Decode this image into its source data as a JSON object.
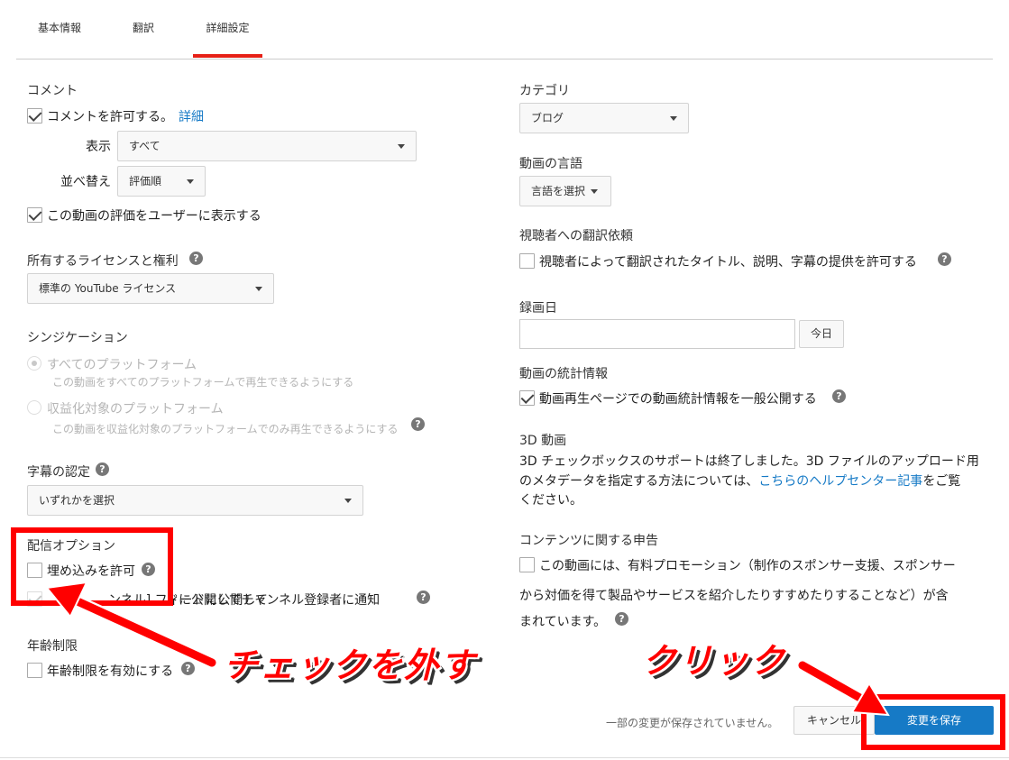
{
  "tabs": [
    "基本情報",
    "翻訳",
    "詳細設定"
  ],
  "left": {
    "comments": {
      "title": "コメント",
      "allow_label": "コメントを許可する。",
      "detail_link": "詳細",
      "display_label": "表示",
      "display_value": "すべて",
      "sort_label": "並べ替え",
      "sort_value": "評価順",
      "show_ratings_label": "この動画の評価をユーザーに表示する"
    },
    "license": {
      "title": "所有するライセンスと権利",
      "value": "標準の YouTube ライセンス"
    },
    "syndication": {
      "title": "シンジケーション",
      "all_platforms": "すべてのプラットフォーム",
      "all_platforms_desc": "この動画をすべてのプラットフォームで再生できるようにする",
      "monetized_platforms": "収益化対象のプラットフォーム",
      "monetized_platforms_desc": "この動画を収益化対象のプラットフォームでのみ再生できるようにする"
    },
    "caption_cert": {
      "title": "字幕の認定",
      "value": "いずれかを選択"
    },
    "distribution": {
      "title": "配信オプション",
      "embed_label": "埋め込みを許可",
      "notify_prefix": "ド",
      "notify_label": "チャンネル登録者に通知",
      "notify_partial": "ンネル] フィードに公開して"
    },
    "age": {
      "title": "年齢制限",
      "enable_label": "年齢制限を有効にする"
    }
  },
  "right": {
    "category": {
      "title": "カテゴリ",
      "value": "ブログ"
    },
    "language": {
      "title": "動画の言語",
      "value": "言語を選択"
    },
    "translation": {
      "title": "視聴者への翻訳依頼",
      "label": "視聴者によって翻訳されたタイトル、説明、字幕の提供を許可する"
    },
    "recording": {
      "title": "録画日",
      "today_button": "今日"
    },
    "stats": {
      "title": "動画の統計情報",
      "label": "動画再生ページでの動画統計情報を一般公開する"
    },
    "video3d": {
      "title": "3D 動画",
      "line1": "3D チェックボックスのサポートは終了しました。3D ファイルのアップロード用",
      "line2_prefix": "のメタデータを指定する方法については、",
      "line2_link": "こちらのヘルプセンター記事",
      "line2_suffix": "をご覧",
      "line3": "ください。"
    },
    "content_declaration": {
      "title": "コンテンツに関する申告",
      "line1": "この動画には、有料プロモーション（制作のスポンサー支援、スポンサー",
      "line2": "から対価を得て製品やサービスを紹介したりすすめたりすることなど）が含",
      "line3": "まれています。"
    }
  },
  "footer": {
    "unsaved": "一部の変更が保存されていません。",
    "cancel": "キャンセル",
    "save": "変更を保存"
  },
  "annotations": {
    "uncheck": "チェックを外す",
    "click": "クリック"
  },
  "colors": {
    "accent": "#e62117",
    "link": "#167ac6",
    "primary_button": "#167ac6",
    "annotation": "#ff0000"
  },
  "icons": [
    "help-icon",
    "checkbox-icon",
    "radio-icon",
    "dropdown-caret-icon",
    "red-arrow-icon"
  ]
}
